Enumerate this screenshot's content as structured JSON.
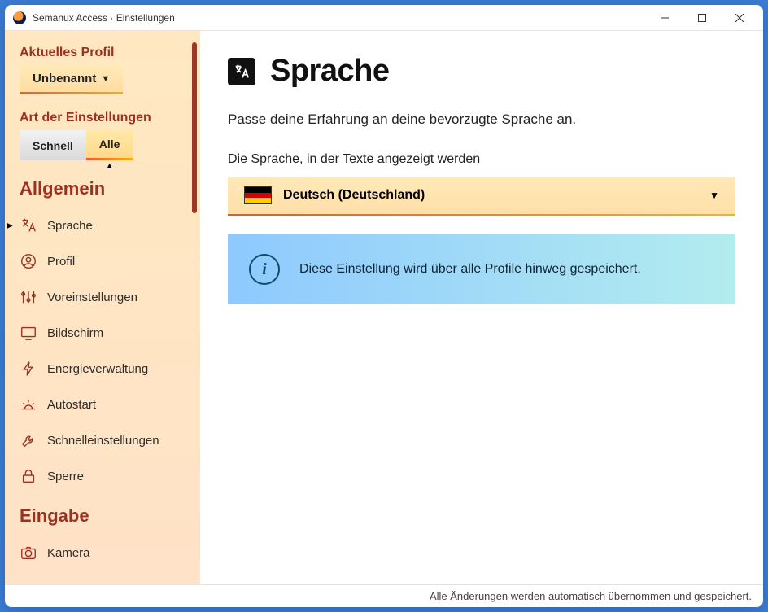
{
  "title": "Semanux Access · Einstellungen",
  "sidebar": {
    "profile_section_label": "Aktuelles Profil",
    "profile_name": "Unbenannt",
    "settings_kind_label": "Art der Einstellungen",
    "seg_schnell": "Schnell",
    "seg_alle": "Alle",
    "cat_general": "Allgemein",
    "items_general": [
      {
        "label": "Sprache"
      },
      {
        "label": "Profil"
      },
      {
        "label": "Voreinstellungen"
      },
      {
        "label": "Bildschirm"
      },
      {
        "label": "Energieverwaltung"
      },
      {
        "label": "Autostart"
      },
      {
        "label": "Schnelleinstellungen"
      },
      {
        "label": "Sperre"
      }
    ],
    "cat_input": "Eingabe",
    "items_input": [
      {
        "label": "Kamera"
      }
    ]
  },
  "main": {
    "heading": "Sprache",
    "subtitle": "Passe deine Erfahrung an deine bevorzugte Sprache an.",
    "field_label": "Die Sprache, in der Texte angezeigt werden",
    "selected_language": "Deutsch (Deutschland)",
    "info_text": "Diese Einstellung wird über alle Profile hinweg gespeichert."
  },
  "statusbar": "Alle Änderungen werden automatisch übernommen und gespeichert."
}
